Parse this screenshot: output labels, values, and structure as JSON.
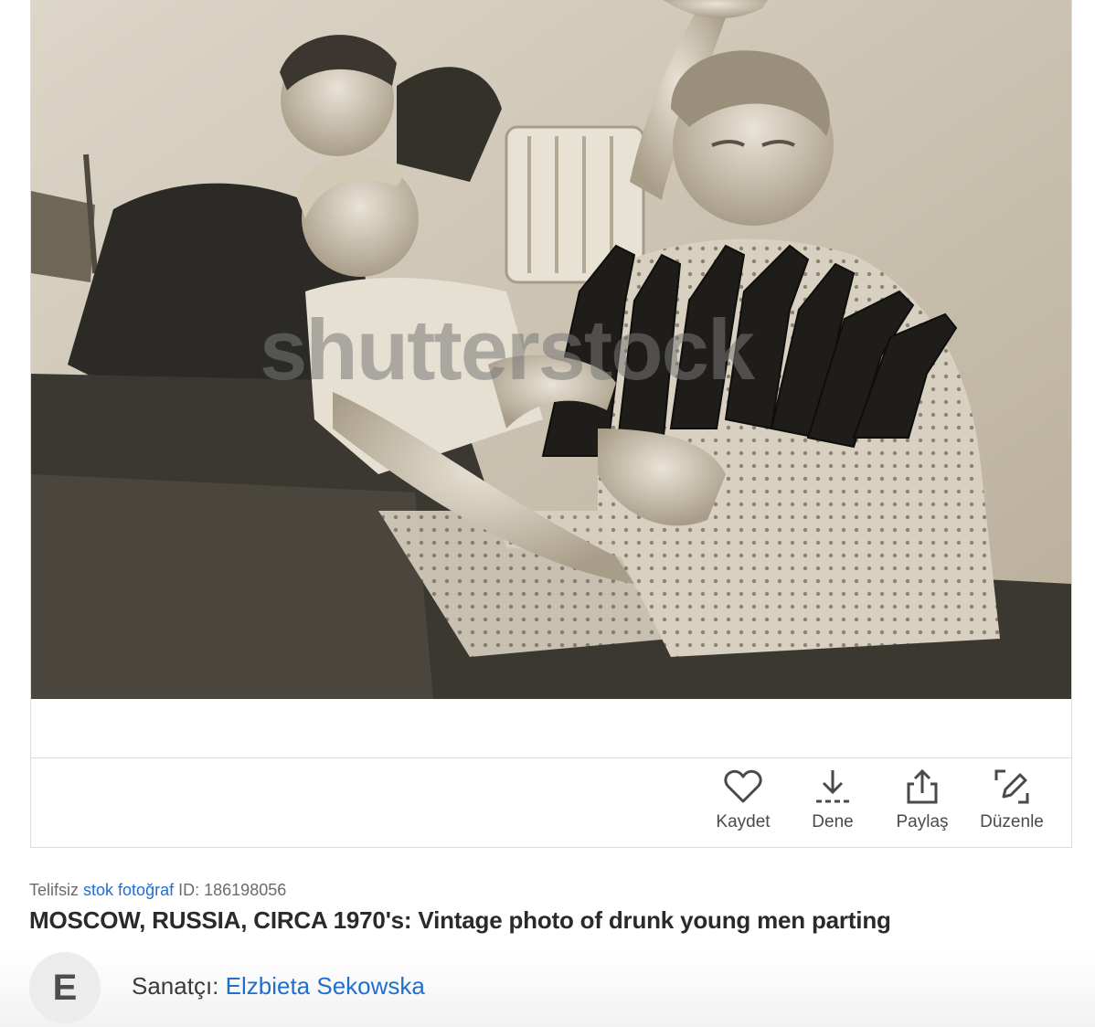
{
  "photo": {
    "watermark": "shutterstock",
    "description_icon": "stock-photo"
  },
  "actions": [
    {
      "label": "Kaydet",
      "icon": "heart-icon"
    },
    {
      "label": "Dene",
      "icon": "download-icon"
    },
    {
      "label": "Paylaş",
      "icon": "share-icon"
    },
    {
      "label": "Düzenle",
      "icon": "edit-icon"
    }
  ],
  "meta": {
    "prefix": "Telifsiz",
    "link": "stok fotoğraf",
    "id_label": "ID:",
    "id": "186198056"
  },
  "title": "MOSCOW, RUSSIA, CIRCA 1970's: Vintage photo of drunk young men parting",
  "artist": {
    "initial": "E",
    "label": "Sanatçı:",
    "name": "Elzbieta Sekowska"
  },
  "colors": {
    "link": "#1f6fd1",
    "text": "#2e2e2e",
    "muted": "#6b6b6b"
  }
}
